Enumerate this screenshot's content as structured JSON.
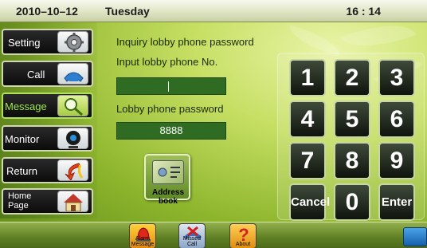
{
  "status_bar": {
    "date": "2010–10–12",
    "day": "Tuesday",
    "time": "16 : 14"
  },
  "sidebar": {
    "items": [
      {
        "label": "Setting",
        "icon": "gear-icon"
      },
      {
        "label": "Call",
        "icon": "phone-icon"
      },
      {
        "label": "Message",
        "icon": "magnifier-icon",
        "active": true
      },
      {
        "label": "Monitor",
        "icon": "camera-icon"
      },
      {
        "label": "Return",
        "icon": "return-arrow-icon"
      },
      {
        "label": "Home Page",
        "icon": "house-icon"
      }
    ]
  },
  "main": {
    "heading": "Inquiry lobby phone password",
    "phone_no_label": "Input lobby phone No.",
    "phone_no_value": "",
    "password_label": "Lobby phone password",
    "password_value": "8888",
    "address_book_label": "Address book"
  },
  "keypad": {
    "keys": [
      "1",
      "2",
      "3",
      "4",
      "5",
      "6",
      "7",
      "8",
      "9",
      "Cancel",
      "0",
      "Enter"
    ]
  },
  "bottom_bar": {
    "items": [
      {
        "label": "Alarm Message",
        "icon": "alarm-icon"
      },
      {
        "label": "Missed Call",
        "icon": "missed-call-icon"
      },
      {
        "label": "About",
        "icon": "question-icon"
      }
    ]
  },
  "colors": {
    "accent_active": "#9ee84a",
    "field_bg": "#2f6b23",
    "key_bg": "#0f140d"
  }
}
